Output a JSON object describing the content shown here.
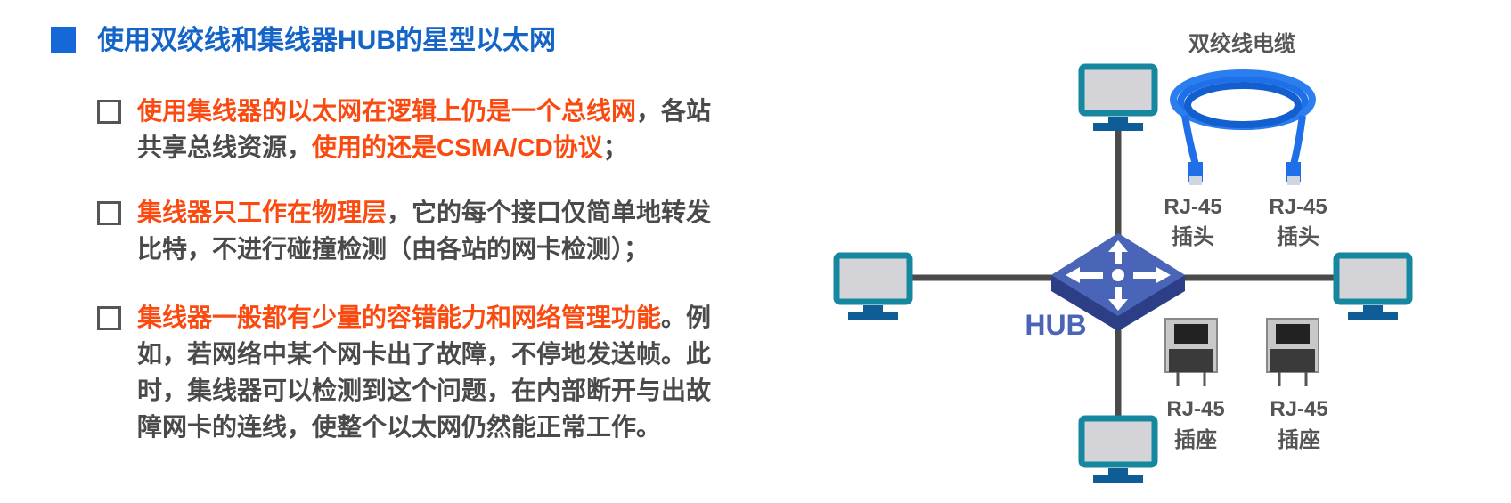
{
  "title": "使用双绞线和集线器HUB的星型以太网",
  "bullets": [
    {
      "lines": [
        [
          {
            "t": "使用集线器的以太网在逻辑上仍是一个总线网",
            "c": "red"
          },
          {
            "t": "，各站",
            "c": "gray"
          }
        ],
        [
          {
            "t": "共享总线资源，",
            "c": "gray"
          },
          {
            "t": "使用的还是CSMA/CD协议",
            "c": "red"
          },
          {
            "t": "；",
            "c": "gray"
          }
        ]
      ]
    },
    {
      "lines": [
        [
          {
            "t": "集线器只工作在物理层",
            "c": "red"
          },
          {
            "t": "，它的每个接口仅简单地转发",
            "c": "gray"
          }
        ],
        [
          {
            "t": "比特，不进行碰撞检测（由各站的网卡检测）；",
            "c": "gray"
          }
        ]
      ]
    },
    {
      "lines": [
        [
          {
            "t": "集线器一般都有少量的容错能力和网络管理功能",
            "c": "red"
          },
          {
            "t": "。例",
            "c": "gray"
          }
        ],
        [
          {
            "t": "如，若网络中某个网卡出了故障，不停地发送帧。此",
            "c": "gray"
          }
        ],
        [
          {
            "t": "时，集线器可以检测到这个问题，在内部断开与出故",
            "c": "gray"
          }
        ],
        [
          {
            "t": "障网卡的连线，使整个以太网仍然能正常工作。",
            "c": "gray"
          }
        ]
      ]
    }
  ],
  "diagram": {
    "hub_label": "HUB",
    "cable_label": "双绞线电缆",
    "plug_labels": [
      [
        "RJ-45",
        "插头"
      ],
      [
        "RJ-45",
        "插头"
      ]
    ],
    "socket_labels": [
      [
        "RJ-45",
        "插座"
      ],
      [
        "RJ-45",
        "插座"
      ]
    ]
  },
  "colors": {
    "title": "#1565c8",
    "highlight": "#fa4a10",
    "body": "#4a4a4a",
    "monitor": "#16879e",
    "hub": "#3f5aa8",
    "cable": "#1e6fe8"
  }
}
